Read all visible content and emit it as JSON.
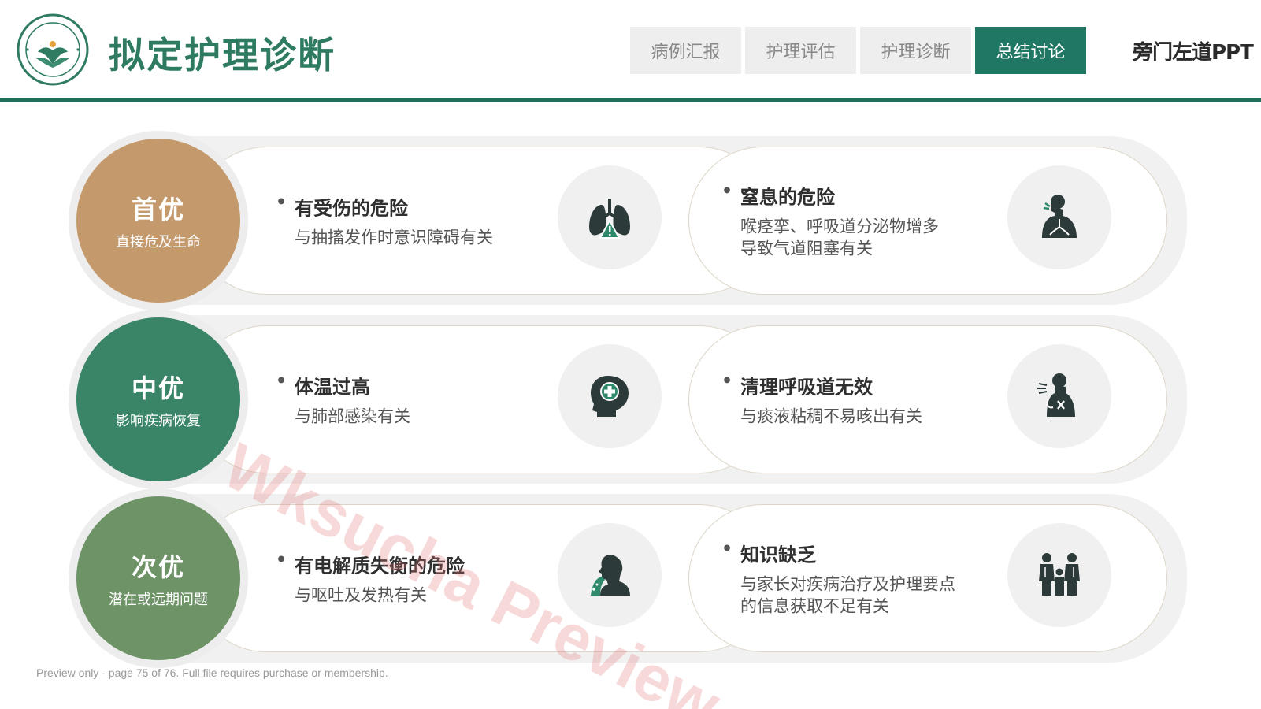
{
  "header": {
    "title": "拟定护理诊断",
    "brand": "旁门左道PPT",
    "tabs": [
      {
        "label": "病例汇报",
        "active": false
      },
      {
        "label": "护理评估",
        "active": false
      },
      {
        "label": "护理诊断",
        "active": false
      },
      {
        "label": "总结讨论",
        "active": true
      }
    ]
  },
  "colors": {
    "accent": "#1f7764",
    "title": "#2e7b62",
    "priority_first": "#c49a6c",
    "priority_middle": "#3a8468",
    "priority_low": "#6e9367"
  },
  "rows": [
    {
      "badge_title": "首优",
      "badge_sub": "直接危及生命",
      "items": [
        {
          "title": "有受伤的危险",
          "desc": [
            "与抽搐发作时意识障碍有关"
          ],
          "icon": "lungs-warning-icon"
        },
        {
          "title": "窒息的危险",
          "desc": [
            "喉痉挛、呼吸道分泌物增多",
            "导致气道阻塞有关"
          ],
          "icon": "respiratory-system-icon"
        }
      ]
    },
    {
      "badge_title": "中优",
      "badge_sub": "影响疾病恢复",
      "items": [
        {
          "title": "体温过高",
          "desc": [
            "与肺部感染有关"
          ],
          "icon": "head-medical-cross-icon"
        },
        {
          "title": "清理呼吸道无效",
          "desc": [
            "与痰液粘稠不易咳出有关"
          ],
          "icon": "cough-icon"
        }
      ]
    },
    {
      "badge_title": "次优",
      "badge_sub": "潜在或远期问题",
      "items": [
        {
          "title": "有电解质失衡的危险",
          "desc": [
            "与呕吐及发热有关"
          ],
          "icon": "vomiting-icon"
        },
        {
          "title": "知识缺乏",
          "desc": [
            "与家长对疾病治疗及护理要点",
            "的信息获取不足有关"
          ],
          "icon": "family-icon"
        }
      ]
    }
  ],
  "footer_note": "Preview only - page 75 of 76. Full file requires purchase or membership.",
  "watermark": "Wksucha Preview"
}
